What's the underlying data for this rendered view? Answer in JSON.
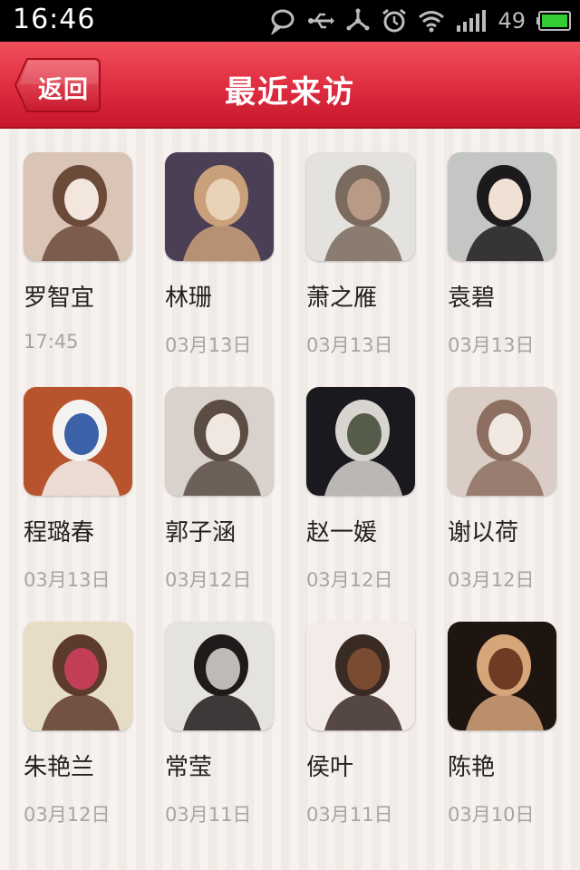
{
  "status_bar": {
    "time": "16:46",
    "battery_percent": "49",
    "icons": [
      "chat-bubble-icon",
      "usb-icon",
      "share-icon",
      "alarm-icon",
      "wifi-icon",
      "signal-icon",
      "battery-icon"
    ]
  },
  "header": {
    "back_label": "返回",
    "title": "最近来访"
  },
  "colors": {
    "header_red": "#e23244",
    "battery_green": "#33cc33",
    "time_gray": "#a8a4a2"
  },
  "visitors": [
    {
      "name": "罗智宜",
      "time": "17:45"
    },
    {
      "name": "林珊",
      "time": "03月13日"
    },
    {
      "name": "萧之雁",
      "time": "03月13日"
    },
    {
      "name": "袁碧",
      "time": "03月13日"
    },
    {
      "name": "程璐春",
      "time": "03月13日"
    },
    {
      "name": "郭子涵",
      "time": "03月12日"
    },
    {
      "name": "赵一媛",
      "time": "03月12日"
    },
    {
      "name": "谢以荷",
      "time": "03月12日"
    },
    {
      "name": "朱艳兰",
      "time": "03月12日"
    },
    {
      "name": "常莹",
      "time": "03月11日"
    },
    {
      "name": "侯叶",
      "time": "03月11日"
    },
    {
      "name": "陈艳",
      "time": "03月10日"
    }
  ]
}
